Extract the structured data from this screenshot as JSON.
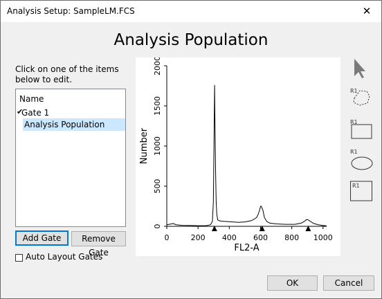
{
  "window": {
    "title": "Analysis Setup:  SampleLM.FCS",
    "close_glyph": "✕"
  },
  "heading": "Analysis Population",
  "instructions": [
    "Click on one of the items",
    "below to edit."
  ],
  "tree": {
    "header": "Name",
    "items": [
      {
        "label": "Gate 1",
        "checked": true,
        "level": 0
      },
      {
        "label": "Analysis Population",
        "selected": true,
        "level": 1
      }
    ]
  },
  "buttons": {
    "add_gate": "Add Gate",
    "remove_gate": "Remove Gate",
    "ok": "OK",
    "cancel": "Cancel"
  },
  "auto_layout": {
    "label": "Auto Layout Gates",
    "checked": false
  },
  "tools": [
    {
      "name": "pointer-tool",
      "label": ""
    },
    {
      "name": "polygon-gate-tool",
      "label": "R1"
    },
    {
      "name": "rectangle-gate-tool",
      "label": "R1"
    },
    {
      "name": "ellipse-gate-tool",
      "label": "R1"
    },
    {
      "name": "quadrant-gate-tool",
      "label": "R1"
    }
  ],
  "chart_data": {
    "type": "line",
    "xlabel": "FL2-A",
    "ylabel": "Number",
    "xlim": [
      0,
      1023
    ],
    "ylim": [
      0,
      2000
    ],
    "xticks": [
      0,
      200,
      400,
      600,
      800,
      1000
    ],
    "yticks": [
      0,
      500,
      1000,
      1500,
      2000
    ],
    "markers_x": [
      305,
      610,
      905
    ],
    "series": [
      {
        "x": [
          0,
          30,
          40,
          60,
          100,
          150,
          200,
          250,
          280,
          292,
          298,
          302,
          306,
          308,
          312,
          316,
          320,
          326,
          335,
          350,
          380,
          420,
          460,
          500,
          540,
          560,
          575,
          585,
          595,
          600,
          605,
          615,
          625,
          640,
          660,
          700,
          760,
          820,
          860,
          880,
          895,
          905,
          920,
          940,
          970,
          1000,
          1023
        ],
        "values": [
          20,
          30,
          35,
          20,
          12,
          10,
          8,
          8,
          20,
          60,
          300,
          1000,
          1760,
          1400,
          700,
          300,
          150,
          80,
          70,
          65,
          60,
          55,
          50,
          55,
          70,
          90,
          110,
          150,
          210,
          250,
          250,
          200,
          110,
          60,
          40,
          30,
          25,
          25,
          40,
          60,
          85,
          80,
          60,
          35,
          20,
          10,
          5
        ]
      }
    ]
  }
}
